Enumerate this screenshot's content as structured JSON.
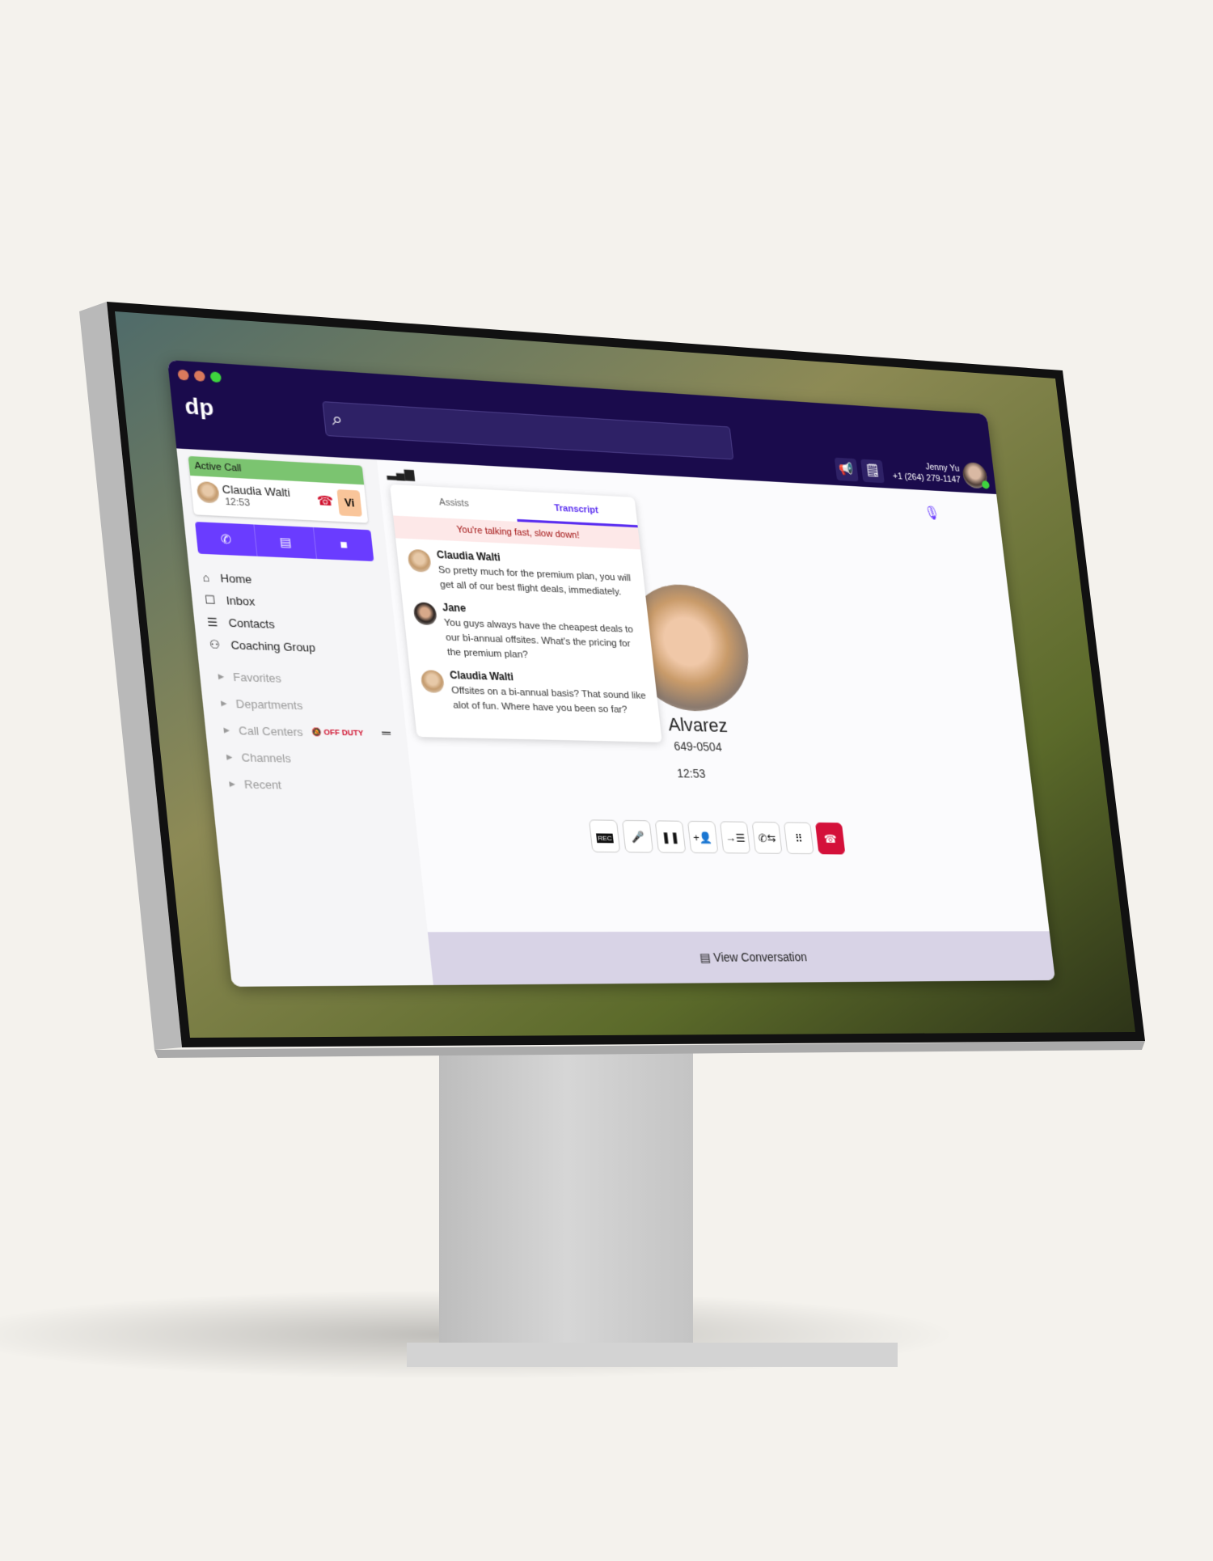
{
  "window": {
    "traffic_lights": [
      "#d9795c",
      "#d9795c",
      "#3ed43e"
    ]
  },
  "header": {
    "logo": "dp",
    "search_placeholder": "",
    "icons": [
      "megaphone-icon",
      "notes-icon"
    ],
    "user_name": "Jenny Yu",
    "user_phone": "+1 (264) 279-1147",
    "status_color": "#3ed43e"
  },
  "sidebar": {
    "active_call": {
      "label": "Active Call",
      "name": "Claudia Walti",
      "time": "12:53",
      "badge": "Vi"
    },
    "call_actions": [
      "phone-icon",
      "message-icon",
      "video-icon"
    ],
    "nav": [
      {
        "label": "Home",
        "icon": "home-icon"
      },
      {
        "label": "Inbox",
        "icon": "inbox-icon"
      },
      {
        "label": "Contacts",
        "icon": "contacts-icon"
      },
      {
        "label": "Coaching Group",
        "icon": "coaching-group-icon"
      }
    ],
    "sections": [
      "Favorites",
      "Departments",
      "Call Centers",
      "Channels",
      "Recent"
    ],
    "off_duty": "OFF DUTY"
  },
  "popover": {
    "tabs": [
      "Assists",
      "Transcript"
    ],
    "active_tab": "Transcript",
    "warning": "You're talking fast, slow down!",
    "messages": [
      {
        "name": "Claudia Walti",
        "text": "So pretty much for the premium plan, you will get all of our best flight deals, immediately."
      },
      {
        "name": "Jane",
        "text": "You guys always have the cheapest deals to our bi-annual offsites. What's the pricing for the premium plan?"
      },
      {
        "name": "Claudia Walti",
        "text": "Offsites on a bi-annual basis? That sound like alot of fun. Where have you been so far?"
      }
    ]
  },
  "call": {
    "name": "Alvarez",
    "number": "649-0504",
    "duration": "12:53",
    "rec_label": "REC"
  },
  "bottom": {
    "label": "View Conversation"
  }
}
